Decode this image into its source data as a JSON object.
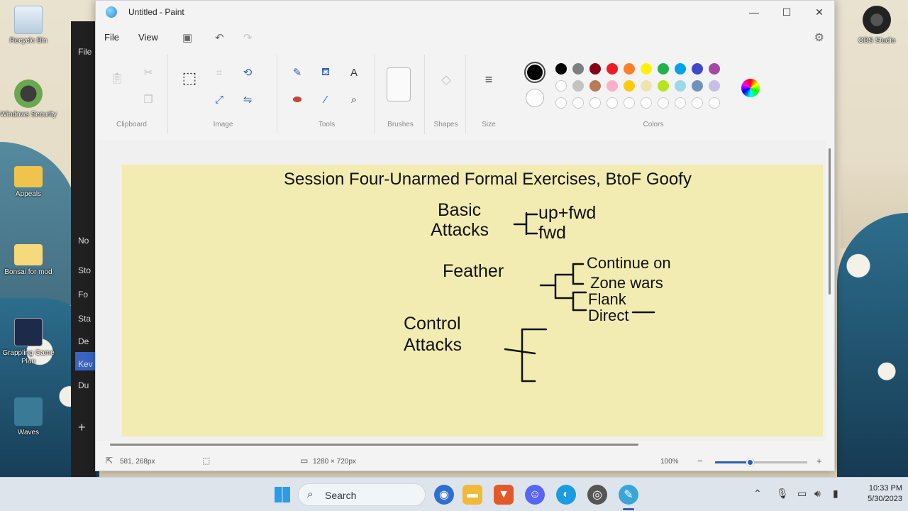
{
  "desktop": {
    "icons": [
      {
        "label": "Recycle Bin"
      },
      {
        "label": "Windows Security"
      },
      {
        "label": "Appeals"
      },
      {
        "label": "Bonsai for mod"
      },
      {
        "label": "Grappling Game Plan"
      },
      {
        "label": "Waves"
      },
      {
        "label": "OBS Studio"
      }
    ],
    "bg_app_items": [
      "File",
      "No",
      "Sto",
      "Fo",
      "Sta",
      "De",
      "Kev",
      "Du",
      "+"
    ]
  },
  "paint": {
    "title": "Untitled - Paint",
    "menu": {
      "file": "File",
      "view": "View"
    },
    "groups": {
      "clipboard": "Clipboard",
      "image": "Image",
      "tools": "Tools",
      "brushes": "Brushes",
      "shapes": "Shapes",
      "size": "Size",
      "colors": "Colors"
    },
    "palette": {
      "row1": [
        "#000000",
        "#7f7f7f",
        "#880015",
        "#ed1c24",
        "#ff7f27",
        "#fff200",
        "#22b14c",
        "#00a2e8",
        "#3f48cc",
        "#a349a4"
      ],
      "row2": [
        "#ffffff",
        "#c3c3c3",
        "#b97a57",
        "#ffaec9",
        "#ffc90e",
        "#efe4b0",
        "#b5e61d",
        "#99d9ea",
        "#7092be",
        "#c8bfe7"
      ],
      "empty_count": 10,
      "primary": "#000000",
      "secondary": "#ffffff"
    },
    "canvas": {
      "background": "#f3ecb2",
      "heading": "Session Four-Unarmed Formal Exercises, BtoF Goofy",
      "labels": {
        "basic_attacks_1": "Basic",
        "basic_attacks_2": "Attacks",
        "upfwd": "up+fwd",
        "fwd": "fwd",
        "feather": "Feather",
        "continue_on": "Continue on",
        "zone_wars": "Zone wars",
        "flank": "Flank",
        "direct": "Direct",
        "control_1": "Control",
        "control_2": "Attacks"
      }
    },
    "status": {
      "cursor_pos": "581, 268px",
      "canvas_size": "1280 × 720px",
      "zoom": "100%"
    }
  },
  "taskbar": {
    "search_label": "Search",
    "time": "10:33 PM",
    "date": "5/30/2023"
  }
}
